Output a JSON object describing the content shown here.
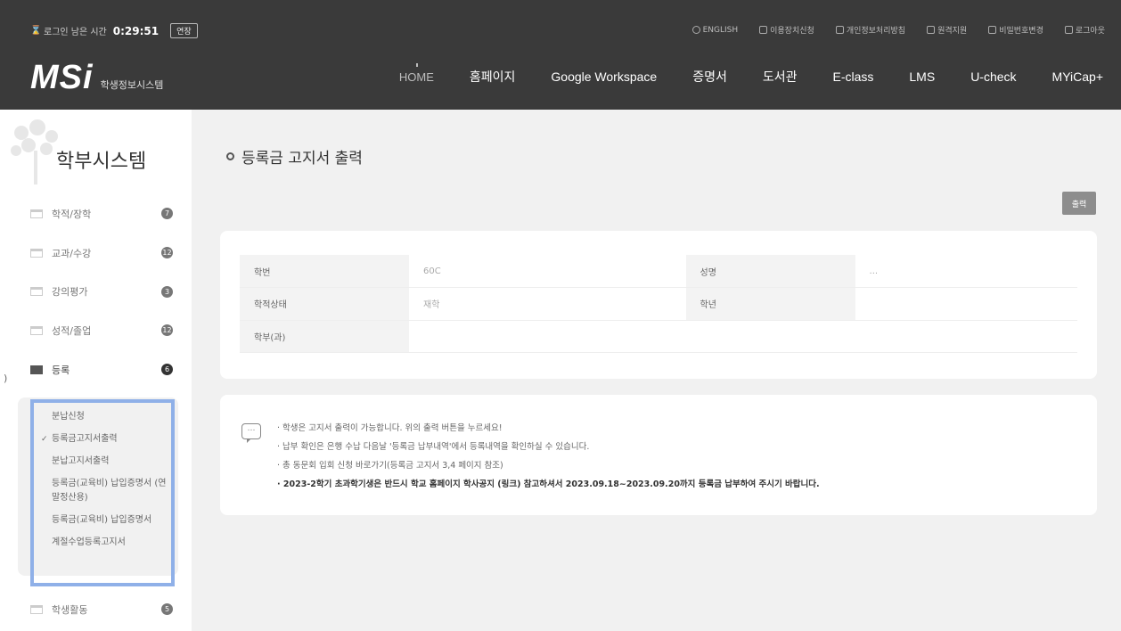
{
  "header": {
    "timer_label": "로그인 남은 시간",
    "timer_value": "0:29:51",
    "extend_label": "연장",
    "top_links": [
      "ENGLISH",
      "이용장치신청",
      "개인정보처리방침",
      "원격지원",
      "비밀번호변경",
      "로그아웃"
    ],
    "logo_text": "MSi",
    "logo_sub": "학생정보시스템",
    "nav": [
      "HOME",
      "홈페이지",
      "Google Workspace",
      "증명서",
      "도서관",
      "E-class",
      "LMS",
      "U-check",
      "MYiCap+"
    ]
  },
  "sidebar": {
    "title": "학부시스템",
    "items": [
      {
        "label": "학적/장학",
        "count": "7"
      },
      {
        "label": "교과/수강",
        "count": "12"
      },
      {
        "label": "강의평가",
        "count": "3"
      },
      {
        "label": "성적/졸업",
        "count": "12"
      },
      {
        "label": "등록",
        "count": "6"
      }
    ],
    "submenu": [
      "분납신청",
      "등록금고지서출력",
      "분납고지서출력",
      "등록금(교육비) 납입증명서 (연말정산용)",
      "등록금(교육비) 납입증명서",
      "계절수업등록고지서"
    ],
    "bottom_item": {
      "label": "학생활동",
      "count": "5"
    }
  },
  "main": {
    "page_title": "등록금 고지서 출력",
    "print_label": "출력",
    "info": {
      "student_id_label": "학번",
      "student_id_value": "60⁠C",
      "name_label": "성명",
      "name_value": "...",
      "status_label": "학적상태",
      "status_value": "재학",
      "grade_label": "학년",
      "grade_value": "",
      "dept_label": "학부(과)",
      "dept_value": ""
    },
    "notices": [
      "학생은 고지서 출력이 가능합니다. 위의 출력 버튼을 누르세요!",
      "납부 확인은 은행 수납 다음날 '등록금 납부내역'에서 등록내역을 확인하실 수 있습니다.",
      "총 동문회 입회 신청 바로가기(등록금 고지서 3,4 페이지 참조)",
      "2023-2학기 초과학기생은 반드시 학교 홈페이지 학사공지 (링크) 참고하셔서 2023.09.18~2023.09.20까지 등록금 납부하여 주시기 바랍니다."
    ]
  }
}
